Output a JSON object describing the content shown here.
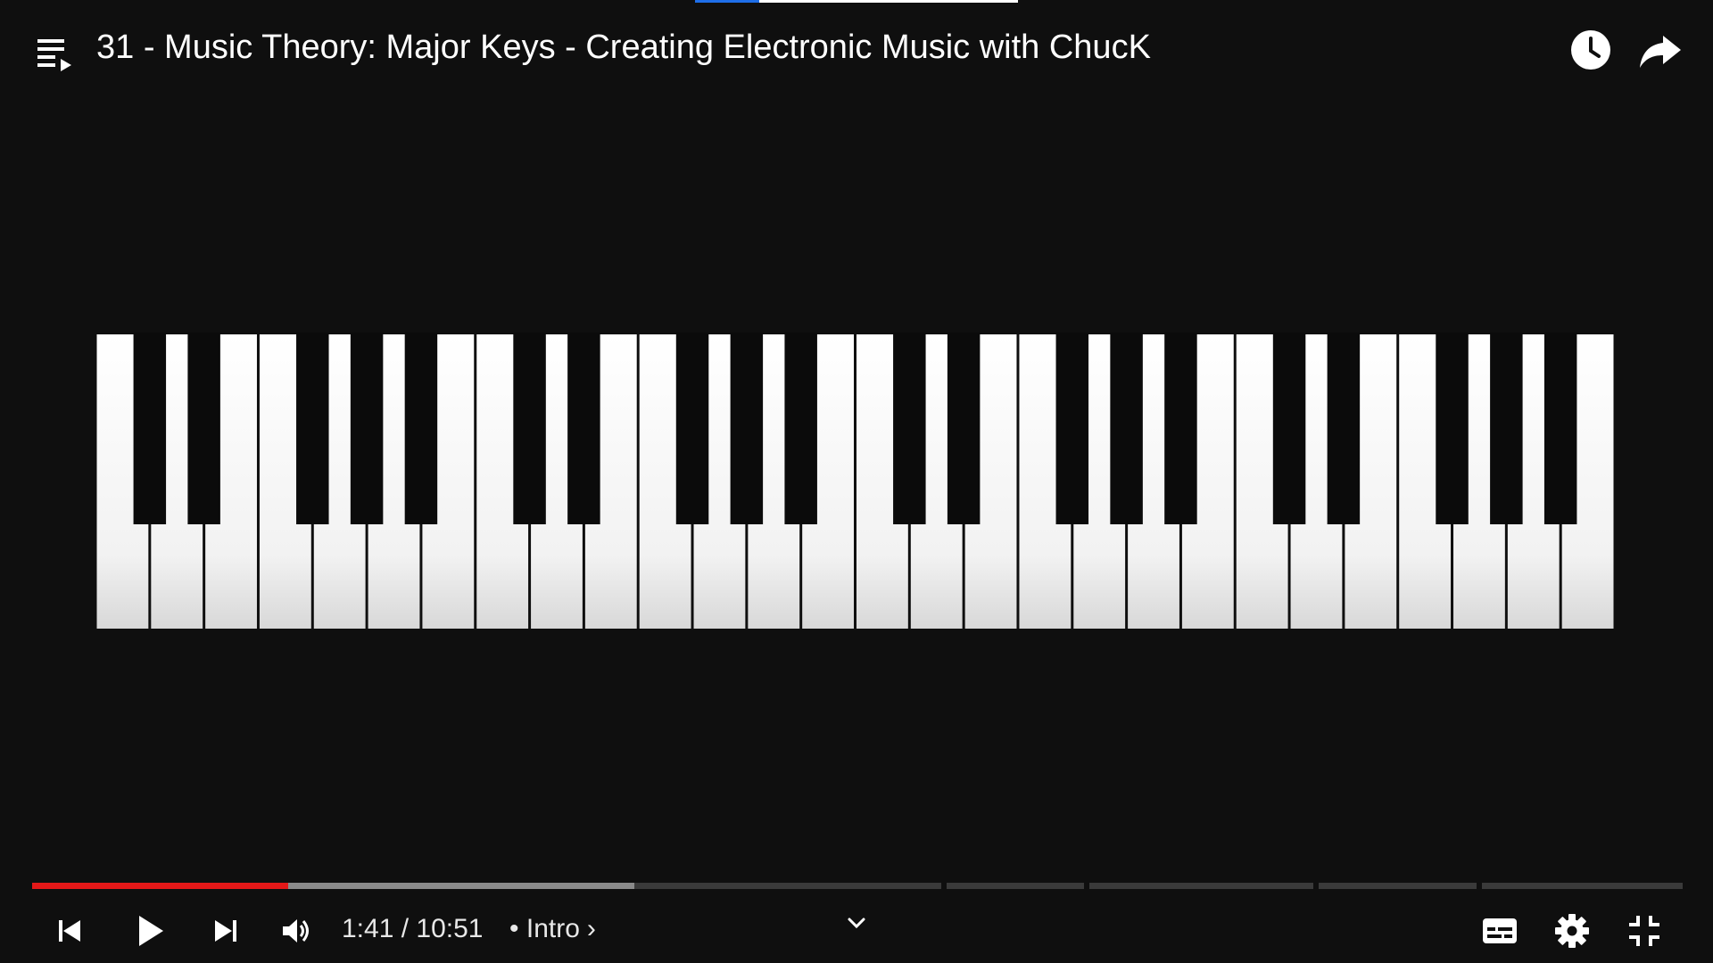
{
  "video": {
    "title": "31 - Music Theory: Major Keys - Creating Electronic Music with ChucK"
  },
  "top_bar": {
    "playlist_icon": "playlist-play-icon",
    "watch_later_icon": "clock-icon",
    "share_icon": "share-arrow-icon"
  },
  "player": {
    "current_time": "1:41",
    "duration": "10:51",
    "time_display": "1:41 / 10:51",
    "chapter_separator": "•",
    "chapter": "Intro",
    "chapter_chevron": "›",
    "progress_fraction": 0.155,
    "buffered_fraction": 0.365
  },
  "controls": {
    "prev_icon": "skip-previous-icon",
    "play_icon": "play-icon",
    "next_icon": "skip-next-icon",
    "volume_icon": "volume-icon",
    "expand_icon": "chevron-down-icon",
    "captions_icon": "subtitles-icon",
    "settings_icon": "gear-icon",
    "exit_fullscreen_icon": "exit-fullscreen-icon"
  },
  "colors": {
    "background": "#0f0f0f",
    "played": "#e41818",
    "buffered": "#8a8a8a",
    "track": "#3a3a3a",
    "white_key": "#f2f2f2",
    "black_key": "#0b0b0b",
    "accent_blue": "#1e6ee8"
  },
  "keyboard": {
    "white_key_count": 28,
    "black_key_pattern": [
      1,
      1,
      0,
      1,
      1,
      1,
      0
    ]
  }
}
